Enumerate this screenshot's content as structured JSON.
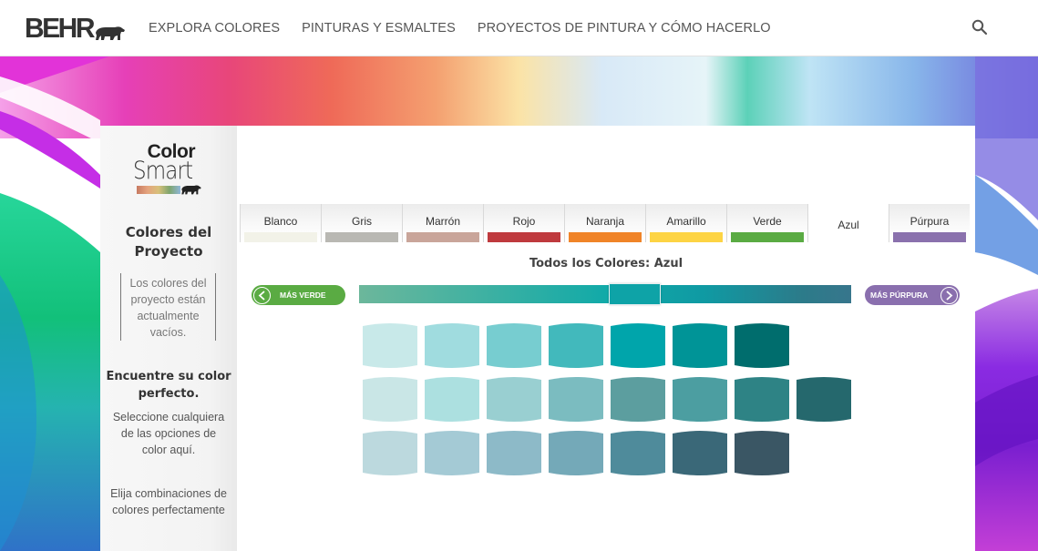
{
  "header": {
    "brand": "BEHR",
    "nav": [
      {
        "label": "EXPLORA COLORES"
      },
      {
        "label": "PINTURAS Y ESMALTES"
      },
      {
        "label": "PROYECTOS DE PINTURA Y CÓMO HACERLO"
      }
    ],
    "search_icon": "search-icon"
  },
  "sidebar": {
    "logo_line1": "Color",
    "logo_line2": "Smart",
    "project_title": "Colores del Proyecto",
    "project_empty": "Los colores del proyecto están actualmente vacíos.",
    "find_title": "Encuentre su color perfecto.",
    "find_text": "Seleccione cualquiera de las opciones de color aquí.",
    "combo_text": "Elija combinaciones de colores perfectamente"
  },
  "tabs": [
    {
      "label": "Blanco",
      "color": "#f2f2e8",
      "active": false
    },
    {
      "label": "Gris",
      "color": "#b9b8b3",
      "active": false
    },
    {
      "label": "Marrón",
      "color": "#c9a59a",
      "active": false
    },
    {
      "label": "Rojo",
      "color": "#bf3a3e",
      "active": false
    },
    {
      "label": "Naranja",
      "color": "#f08428",
      "active": false
    },
    {
      "label": "Amarillo",
      "color": "#fdd444",
      "active": false
    },
    {
      "label": "Verde",
      "color": "#5aab43",
      "active": false
    },
    {
      "label": "Azul",
      "color": "#ffffff",
      "active": true
    },
    {
      "label": "Púrpura",
      "color": "#8a71ad",
      "active": false
    }
  ],
  "palette": {
    "title": "Todos los Colores: Azul",
    "prev_button": "MÁS VERDE",
    "next_button": "MÁS PÚRPURA",
    "slider_position": 0.56,
    "rows": [
      [
        "#c8e9e9",
        "#a0dcdf",
        "#77cdd0",
        "#42b9bc",
        "#00a5ab",
        "#009497",
        "#006d6d"
      ],
      [
        "#c9e6e6",
        "#ace0e0",
        "#99cfd1",
        "#7bbcc0",
        "#5c9e9f",
        "#4c9ea1",
        "#2e8385",
        "#25686d"
      ],
      [
        "#bcd9de",
        "#a4cad5",
        "#8dbac8",
        "#74a9b8",
        "#4f8b9b",
        "#3a6878",
        "#3a5664"
      ]
    ]
  }
}
